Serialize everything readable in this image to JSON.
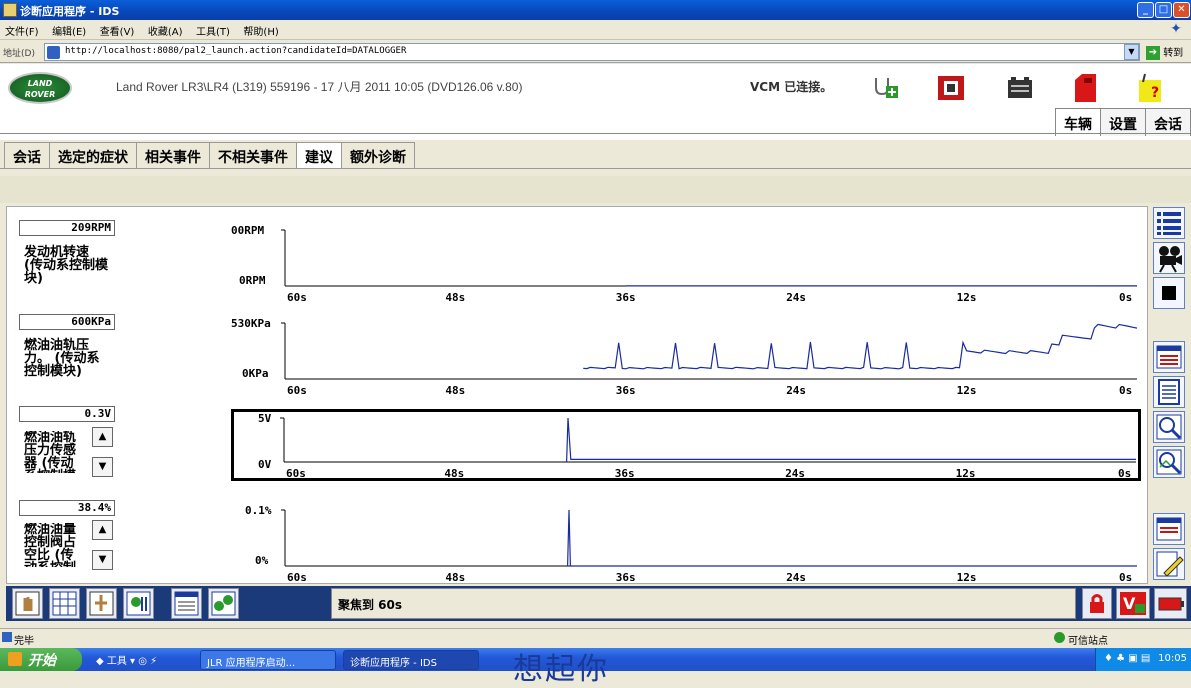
{
  "window": {
    "title": "诊断应用程序 - IDS"
  },
  "menu": [
    "文件(F)",
    "编辑(E)",
    "查看(V)",
    "收藏(A)",
    "工具(T)",
    "帮助(H)"
  ],
  "address": {
    "label": "地址(D)",
    "url": "http://localhost:8080/pal2_launch.action?candidateId=DATALOGGER",
    "go_label": "转到"
  },
  "header": {
    "logo_line1": "LAND",
    "logo_line2": "ROVER",
    "vehicle_info": "Land Rover LR3\\LR4 (L319) 559196 - 17 八月  2011 10:05 (DVD126.06 v.80)",
    "vcm_status": "VCM 已连接。",
    "right_tabs": [
      "车辆",
      "设置",
      "会话"
    ],
    "active_right_tab": "车辆"
  },
  "sub_tabs": [
    "会话",
    "选定的症状",
    "相关事件",
    "不相关事件",
    "建议",
    "额外诊断"
  ],
  "active_sub_tab": "建议",
  "x_ticks": [
    "60s",
    "48s",
    "36s",
    "24s",
    "12s",
    "0s"
  ],
  "signals": [
    {
      "value": "209RPM",
      "label": "发动机转速 (传动系控制模块)",
      "y_max": "00RPM",
      "y_min": "0RPM"
    },
    {
      "value": "600KPa",
      "label": "燃油油轨压力。 (传动系控制模块)",
      "y_max": "530KPa",
      "y_min": "0KPa"
    },
    {
      "value": "0.3V",
      "label": "燃油油轨压力传感器 (传动系控制模",
      "y_max": "5V",
      "y_min": "0V"
    },
    {
      "value": "38.4%",
      "label": "燃油油量控制阀占空比 (传动系控制",
      "y_max": "0.1%",
      "y_min": "0%"
    }
  ],
  "chart_data": [
    {
      "type": "line",
      "title": "",
      "x": [
        60,
        36,
        12,
        0
      ],
      "series": [
        {
          "values": [
            null,
            0.01,
            0.01,
            0.03
          ]
        }
      ],
      "xlabel": "",
      "ylabel": "",
      "x_reversed": true
    },
    {
      "type": "line",
      "title": "",
      "x": [
        60,
        39,
        36,
        30,
        24,
        18,
        13,
        12,
        6,
        3,
        0
      ],
      "series": [
        {
          "values": [
            null,
            0,
            60,
            65,
            60,
            70,
            75,
            150,
            180,
            320,
            300
          ]
        }
      ],
      "x_reversed": true
    },
    {
      "type": "line",
      "title": "",
      "x": [
        60,
        40.1,
        40.0,
        39.8,
        0
      ],
      "series": [
        {
          "values": [
            null,
            0,
            5,
            0.3,
            0.3
          ]
        }
      ],
      "x_reversed": true
    },
    {
      "type": "line",
      "title": "",
      "x": [
        60,
        40.1,
        40.0,
        39.9,
        0
      ],
      "series": [
        {
          "values": [
            null,
            0,
            0.1,
            0,
            0
          ]
        }
      ],
      "x_reversed": true
    }
  ],
  "focus_text": "聚焦到 60s",
  "status": {
    "done": "完毕",
    "trust": "可信站点"
  },
  "taskbar": {
    "start": "开始",
    "tools": "工具",
    "items": [
      "JLR 应用程序启动...",
      "诊断应用程序 - IDS"
    ],
    "clock": "10:05",
    "overlay_text": "想起你"
  }
}
